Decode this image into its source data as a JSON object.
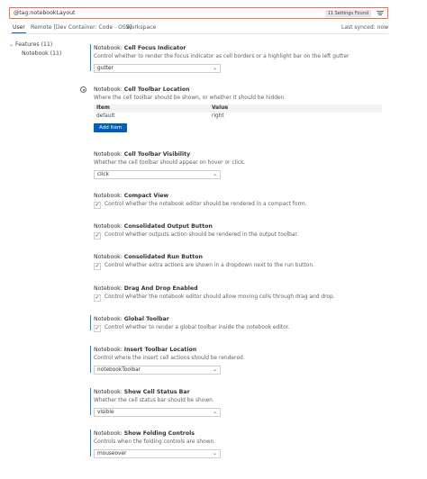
{
  "search": {
    "query": "@tag:notebookLayout",
    "badge": "11 Settings Found",
    "filter_icon": "filter-icon"
  },
  "tabs": [
    {
      "label": "User",
      "active": true
    },
    {
      "label": "Remote [Dev Container: Code - OSS]",
      "active": false
    },
    {
      "label": "Workspace",
      "active": false
    }
  ],
  "synced": "Last synced: now",
  "tree": {
    "features": "Features (11)",
    "notebook": "Notebook (11)"
  },
  "settings": {
    "cell_focus": {
      "category": "Notebook: ",
      "name": "Cell Focus Indicator",
      "desc": "Control whether to render the focus indicator as cell borders or a highlight bar on the left gutter",
      "value": "gutter"
    },
    "cell_toolbar_location": {
      "category": "Notebook: ",
      "name": "Cell Toolbar Location",
      "desc": "Where the cell toolbar should be shown, or whether it should be hidden.",
      "col_item": "Item",
      "col_value": "Value",
      "rows": [
        {
          "item": "default",
          "value": "right"
        }
      ],
      "add_label": "Add Item"
    },
    "cell_toolbar_visibility": {
      "category": "Notebook: ",
      "name": "Cell Toolbar Visibility",
      "desc": "Whether the cell toolbar should appear on hover or click.",
      "value": "click"
    },
    "compact_view": {
      "category": "Notebook: ",
      "name": "Compact View",
      "desc": "Control whether the notebook editor should be rendered in a compact form.",
      "checked": true
    },
    "consolidated_output": {
      "category": "Notebook: ",
      "name": "Consolidated Output Button",
      "desc": "Control whether outputs action should be rendered in the output toolbar.",
      "checked": true
    },
    "consolidated_run": {
      "category": "Notebook: ",
      "name": "Consolidated Run Button",
      "desc": "Control whether extra actions are shown in a dropdown next to the run button.",
      "checked": true
    },
    "drag_drop": {
      "category": "Notebook: ",
      "name": "Drag And Drop Enabled",
      "desc": "Control whether the notebook editor should allow moving cells through drag and drop.",
      "checked": true
    },
    "global_toolbar": {
      "category": "Notebook: ",
      "name": "Global Toolbar",
      "desc": "Control whether to render a global toolbar inside the notebook editor.",
      "checked": true
    },
    "insert_toolbar": {
      "category": "Notebook: ",
      "name": "Insert Toolbar Location",
      "desc": "Control where the insert cell actions should be rendered.",
      "value": "notebookToolbar"
    },
    "cell_status_bar": {
      "category": "Notebook: ",
      "name": "Show Cell Status Bar",
      "desc": "Whether the cell status bar should be shown.",
      "value": "visible"
    },
    "folding_controls": {
      "category": "Notebook: ",
      "name": "Show Folding Controls",
      "desc": "Controls when the folding controls are shown.",
      "value": "mouseover"
    }
  },
  "check_mark": "✓",
  "chevron": "⌄",
  "colors": {
    "accent": "#005fb8",
    "search_border": "#e8734a",
    "modified_bar": "#1a85ff"
  }
}
